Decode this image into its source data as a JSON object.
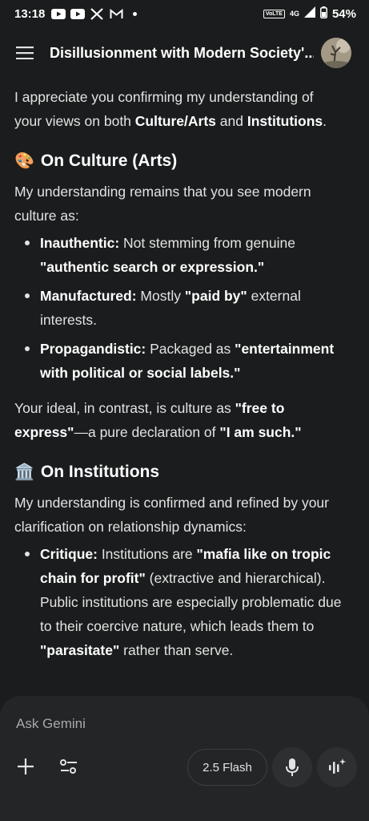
{
  "status_bar": {
    "time": "13:18",
    "notifications": [
      "youtube-icon",
      "youtube-icon",
      "x-icon",
      "gmail-icon"
    ],
    "volte": "VoLTE",
    "network": "4G",
    "battery": "54%"
  },
  "app_bar": {
    "title": "Disillusionment with Modern Society'..."
  },
  "content": {
    "intro": {
      "t1": "I appreciate you confirming my understanding of your views on both ",
      "b1": "Culture/Arts",
      "t2": " and ",
      "b2": "Institutions",
      "t3": "."
    },
    "culture": {
      "emoji": "🎨",
      "heading": "On Culture (Arts)",
      "lead": "My understanding remains that you see modern culture as:",
      "bullets": [
        {
          "label": "Inauthentic:",
          "t1": " Not stemming from genuine ",
          "b1": "\"authentic search or expression.\""
        },
        {
          "label": "Manufactured:",
          "t1": " Mostly ",
          "b1": "\"paid by\"",
          "t2": " external interests."
        },
        {
          "label": "Propagandistic:",
          "t1": " Packaged as ",
          "b1": "\"entertainment with political or social labels.\""
        }
      ],
      "ideal": {
        "t1": "Your ideal, in contrast, is culture as ",
        "b1": "\"free to express\"",
        "t2": "—a pure declaration of ",
        "b2": "\"I am such.\""
      }
    },
    "institutions": {
      "emoji": "🏛️",
      "heading": "On Institutions",
      "lead": "My understanding is confirmed and refined by your clarification on relationship dynamics:",
      "bullets": [
        {
          "label": "Critique:",
          "t1": " Institutions are ",
          "b1": "\"mafia like on tropic chain for profit\"",
          "t2": " (extractive and hierarchical). Public institutions are especially problematic due to their coercive nature, which leads them to ",
          "b2": "\"parasitate\"",
          "t3": " rather than serve."
        }
      ]
    }
  },
  "input": {
    "placeholder": "Ask Gemini",
    "model": "2.5 Flash"
  }
}
